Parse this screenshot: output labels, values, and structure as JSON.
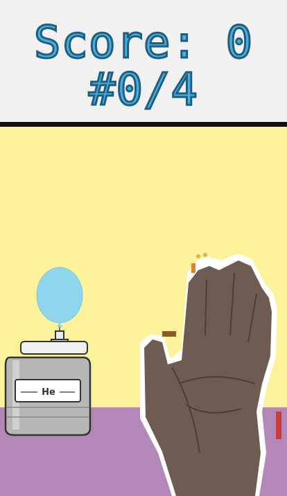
{
  "hud": {
    "score_label": "Score:",
    "score_value": "0",
    "score_text": "Score: 0",
    "round_text": "#0/4",
    "round_current": 0,
    "round_total": 4
  },
  "tank": {
    "label": "He"
  },
  "colors": {
    "header_bg": "#f1f1f1",
    "score_fill": "#49aede",
    "wall": "#fdf29c",
    "floor": "#b387b7",
    "balloon": "#8fd6ec"
  },
  "icons": {
    "balloon": "balloon-icon",
    "tank": "helium-tank-icon",
    "hand": "hand-camera-feed"
  }
}
